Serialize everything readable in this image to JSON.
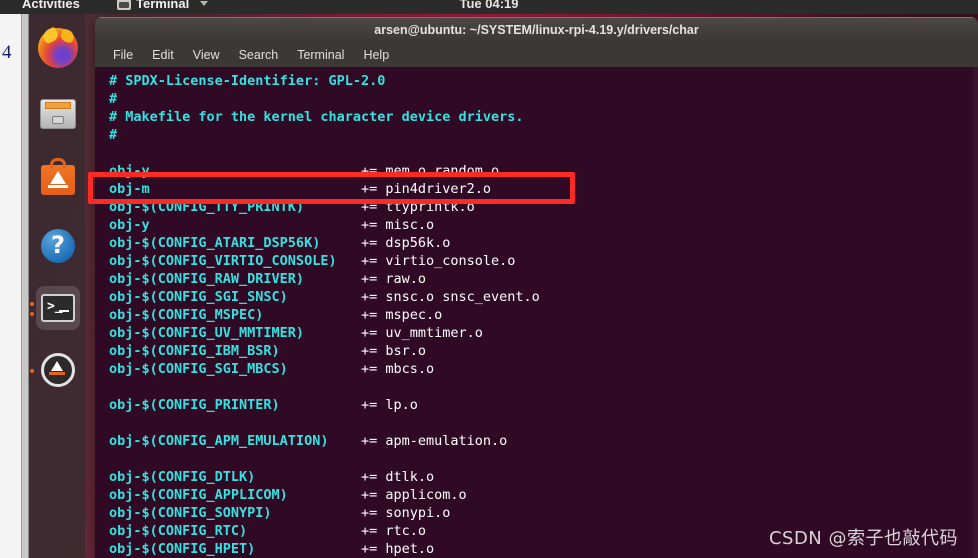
{
  "topbar": {
    "activities": "Activities",
    "app_icon": "terminal-app-icon",
    "app_name": "Terminal",
    "caret_icon": "chevron-down-icon",
    "clock": "Tue 04:19"
  },
  "dock": {
    "items": [
      {
        "name": "firefox",
        "label": "Firefox Web Browser",
        "icon": "firefox-icon",
        "running": false,
        "active": false
      },
      {
        "name": "files",
        "label": "Files",
        "icon": "files-icon",
        "running": false,
        "active": false
      },
      {
        "name": "ubuntu-software",
        "label": "Ubuntu Software",
        "icon": "ubuntu-software-icon",
        "running": false,
        "active": false
      },
      {
        "name": "help",
        "label": "Help",
        "icon": "help-icon",
        "running": false,
        "active": false
      },
      {
        "name": "terminal",
        "label": "Terminal",
        "icon": "terminal-icon",
        "running": true,
        "active": true
      },
      {
        "name": "software-updater",
        "label": "Software Updater",
        "icon": "software-updater-icon",
        "running": true,
        "active": false
      }
    ]
  },
  "background_document": {
    "line_number": "4"
  },
  "terminal": {
    "title": "arsen@ubuntu: ~/SYSTEM/linux-rpi-4.19.y/drivers/char",
    "menu": [
      "File",
      "Edit",
      "View",
      "Search",
      "Terminal",
      "Help"
    ],
    "lines": [
      {
        "key": "# SPDX-License-Identifier: GPL-2.0",
        "value": ""
      },
      {
        "key": "#",
        "value": ""
      },
      {
        "key": "# Makefile for the kernel character device drivers.",
        "value": ""
      },
      {
        "key": "#",
        "value": ""
      },
      {
        "key": "",
        "value": ""
      },
      {
        "key": "obj-y",
        "value": "+= mem.o random.o"
      },
      {
        "key": "obj-m",
        "value": "+= pin4driver2.o"
      },
      {
        "key": "obj-$(CONFIG_TTY_PRINTK)",
        "value": "+= ttyprintk.o"
      },
      {
        "key": "obj-y",
        "value": "+= misc.o"
      },
      {
        "key": "obj-$(CONFIG_ATARI_DSP56K)",
        "value": "+= dsp56k.o"
      },
      {
        "key": "obj-$(CONFIG_VIRTIO_CONSOLE)",
        "value": "+= virtio_console.o"
      },
      {
        "key": "obj-$(CONFIG_RAW_DRIVER)",
        "value": "+= raw.o"
      },
      {
        "key": "obj-$(CONFIG_SGI_SNSC)",
        "value": "+= snsc.o snsc_event.o"
      },
      {
        "key": "obj-$(CONFIG_MSPEC)",
        "value": "+= mspec.o"
      },
      {
        "key": "obj-$(CONFIG_UV_MMTIMER)",
        "value": "+= uv_mmtimer.o"
      },
      {
        "key": "obj-$(CONFIG_IBM_BSR)",
        "value": "+= bsr.o"
      },
      {
        "key": "obj-$(CONFIG_SGI_MBCS)",
        "value": "+= mbcs.o"
      },
      {
        "key": "",
        "value": ""
      },
      {
        "key": "obj-$(CONFIG_PRINTER)",
        "value": "+= lp.o"
      },
      {
        "key": "",
        "value": ""
      },
      {
        "key": "obj-$(CONFIG_APM_EMULATION)",
        "value": "+= apm-emulation.o"
      },
      {
        "key": "",
        "value": ""
      },
      {
        "key": "obj-$(CONFIG_DTLK)",
        "value": "+= dtlk.o"
      },
      {
        "key": "obj-$(CONFIG_APPLICOM)",
        "value": "+= applicom.o"
      },
      {
        "key": "obj-$(CONFIG_SONYPI)",
        "value": "+= sonypi.o"
      },
      {
        "key": "obj-$(CONFIG_RTC)",
        "value": "+= rtc.o"
      },
      {
        "key": "obj-$(CONFIG_HPET)",
        "value": "+= hpet.o"
      }
    ]
  },
  "annotation": {
    "highlight_color": "#fc2b24",
    "highlighted_line": "obj-m                          += pin4driver2.o"
  },
  "watermark": {
    "text": "CSDN @索子也敲代码"
  },
  "colors": {
    "terminal_bg": "#300a24",
    "terminal_cyan": "#34e2e2",
    "terminal_white": "#ffffff",
    "titlebar_accent": "#d05a28",
    "dock_bg": "#3c2a30"
  }
}
